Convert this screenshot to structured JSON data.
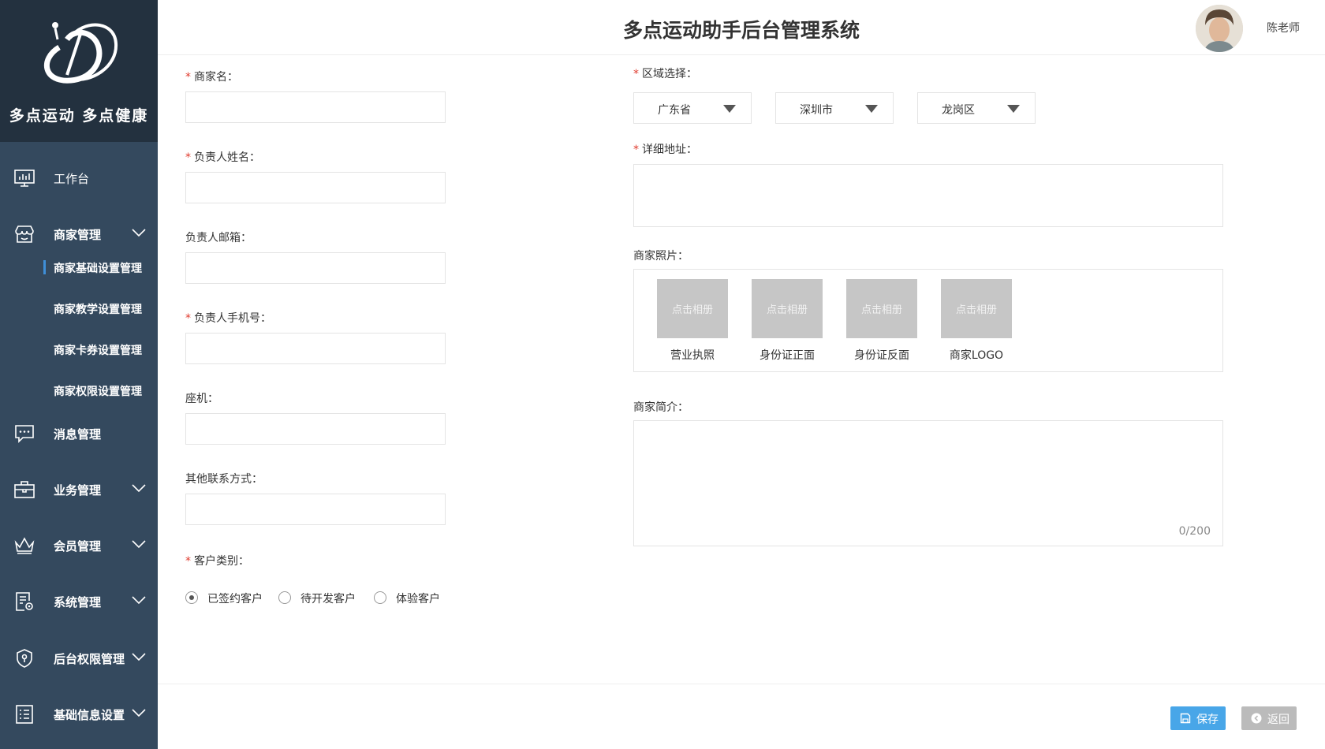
{
  "brand": {
    "slogan": "多点运动 多点健康"
  },
  "header": {
    "title": "多点运动助手后台管理系统",
    "user_name": "陈老师"
  },
  "sidebar": {
    "items": [
      {
        "label": "工作台",
        "icon": "monitor-icon"
      },
      {
        "label": "商家管理",
        "icon": "store-icon",
        "expanded": true,
        "children": [
          "商家基础设置管理",
          "商家教学设置管理",
          "商家卡券设置管理",
          "商家权限设置管理"
        ]
      },
      {
        "label": "消息管理",
        "icon": "message-icon"
      },
      {
        "label": "业务管理",
        "icon": "briefcase-icon"
      },
      {
        "label": "会员管理",
        "icon": "crown-icon"
      },
      {
        "label": "系统管理",
        "icon": "system-settings-icon"
      },
      {
        "label": "后台权限管理",
        "icon": "shield-lock-icon"
      },
      {
        "label": "基础信息设置",
        "icon": "list-icon"
      }
    ],
    "active_child": "商家基础设置管理"
  },
  "form": {
    "merchant_name": {
      "label": "商家名：",
      "required": true,
      "value": ""
    },
    "owner_name": {
      "label": "负责人姓名：",
      "required": true,
      "value": ""
    },
    "owner_email": {
      "label": "负责人邮箱：",
      "required": false,
      "value": ""
    },
    "owner_phone": {
      "label": "负责人手机号：",
      "required": true,
      "value": ""
    },
    "landline": {
      "label": "座机：",
      "required": false,
      "value": ""
    },
    "other_contact": {
      "label": "其他联系方式：",
      "required": false,
      "value": ""
    },
    "customer_type": {
      "label": "客户类别：",
      "required": true,
      "options": [
        "已签约客户",
        "待开发客户",
        "体验客户"
      ],
      "selected": "已签约客户"
    },
    "region": {
      "label": "区域选择：",
      "required": true,
      "province": "广东省",
      "city": "深圳市",
      "district": "龙岗区"
    },
    "address": {
      "label": "详细地址：",
      "required": true,
      "value": ""
    },
    "photos": {
      "label": "商家照片：",
      "upload_text": "点击相册",
      "items": [
        "营业执照",
        "身份证正面",
        "身份证反面",
        "商家LOGO"
      ]
    },
    "intro": {
      "label": "商家简介：",
      "counter": "0/200"
    }
  },
  "actions": {
    "save_label": "保存",
    "back_label": "返回"
  },
  "colors": {
    "sidebar": "#34495e",
    "logo_bg": "#23313f",
    "accent": "#3f8fd8",
    "save": "#48a6e8",
    "back": "#bbbbbb",
    "required": "#e03b2e"
  }
}
